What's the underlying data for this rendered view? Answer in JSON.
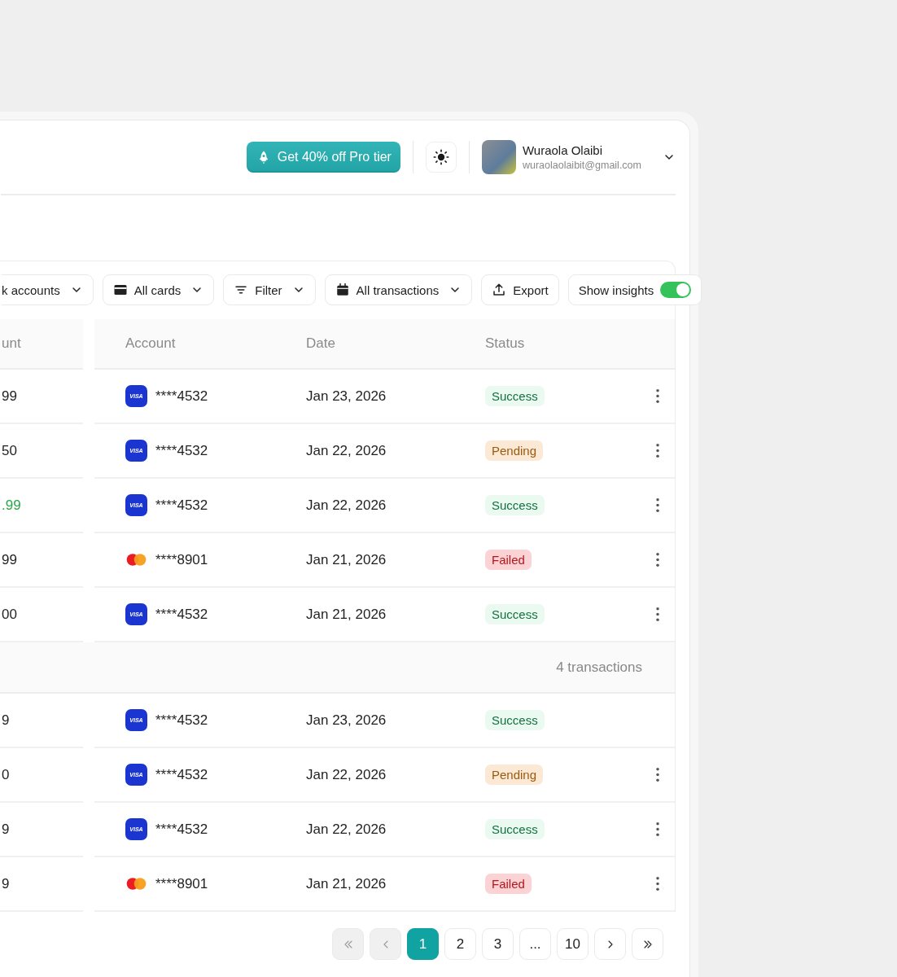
{
  "header": {
    "promo_button": "Get 40% off Pro tier",
    "user": {
      "name": "Wuraola Olaibi",
      "email": "wuraolaolaibit@gmail.com"
    }
  },
  "toolbar": [
    {
      "kind": "dropdown",
      "label": "k accounts"
    },
    {
      "kind": "dropdown",
      "label": "All cards"
    },
    {
      "kind": "dropdown",
      "label": "Filter"
    },
    {
      "kind": "dropdown",
      "label": "All transactions"
    },
    {
      "kind": "button",
      "label": "Export"
    },
    {
      "kind": "toggle",
      "label": "Show insights",
      "on": true
    }
  ],
  "table": {
    "columns": [
      "unt",
      "Account",
      "Date",
      "Status"
    ],
    "sections": [
      {
        "rows": [
          {
            "amount": "99",
            "credit": false,
            "card": {
              "kind": "visa",
              "mark": "VISA"
            },
            "account": "****4532",
            "date": "Jan 23, 2026",
            "status": {
              "kind": "success",
              "label": "Success"
            },
            "menu": true
          },
          {
            "amount": "50",
            "credit": false,
            "card": {
              "kind": "visa",
              "mark": "VISA"
            },
            "account": "****4532",
            "date": "Jan 22, 2026",
            "status": {
              "kind": "pending",
              "label": "Pending"
            },
            "menu": true
          },
          {
            "amount": ".99",
            "credit": true,
            "card": {
              "kind": "visa",
              "mark": "VISA"
            },
            "account": "****4532",
            "date": "Jan 22, 2026",
            "status": {
              "kind": "success",
              "label": "Success"
            },
            "menu": true
          },
          {
            "amount": "99",
            "credit": false,
            "card": {
              "kind": "mastercard"
            },
            "account": "****8901",
            "date": "Jan 21, 2026",
            "status": {
              "kind": "failed",
              "label": "Failed"
            },
            "menu": true
          },
          {
            "amount": "00",
            "credit": false,
            "card": {
              "kind": "visa",
              "mark": "VISA"
            },
            "account": "****4532",
            "date": "Jan 21, 2026",
            "status": {
              "kind": "success",
              "label": "Success"
            },
            "menu": true
          }
        ]
      },
      {
        "summary": "4 transactions",
        "rows": [
          {
            "amount": "9",
            "credit": false,
            "card": {
              "kind": "visa",
              "mark": "VISA"
            },
            "account": "****4532",
            "date": "Jan 23, 2026",
            "status": {
              "kind": "success",
              "label": "Success"
            },
            "menu": false
          },
          {
            "amount": "0",
            "credit": false,
            "card": {
              "kind": "visa",
              "mark": "VISA"
            },
            "account": "****4532",
            "date": "Jan 22, 2026",
            "status": {
              "kind": "pending",
              "label": "Pending"
            },
            "menu": true
          },
          {
            "amount": "9",
            "credit": false,
            "card": {
              "kind": "visa",
              "mark": "VISA"
            },
            "account": "****4532",
            "date": "Jan 22, 2026",
            "status": {
              "kind": "success",
              "label": "Success"
            },
            "menu": true
          },
          {
            "amount": "9",
            "credit": false,
            "card": {
              "kind": "mastercard"
            },
            "account": "****8901",
            "date": "Jan 21, 2026",
            "status": {
              "kind": "failed",
              "label": "Failed"
            },
            "menu": true
          }
        ]
      }
    ]
  },
  "pagination": {
    "first": {
      "disabled": true
    },
    "prev": {
      "disabled": true
    },
    "pages": [
      {
        "label": "1",
        "selected": true
      },
      {
        "label": "2",
        "selected": false
      },
      {
        "label": "3",
        "selected": false
      },
      {
        "label": "...",
        "selected": false
      },
      {
        "label": "10",
        "selected": false
      }
    ],
    "next": {
      "disabled": false
    },
    "last": {
      "disabled": false
    }
  }
}
